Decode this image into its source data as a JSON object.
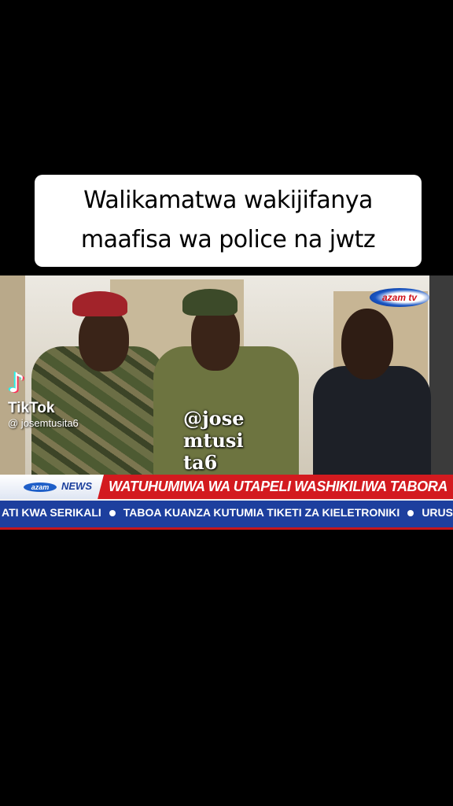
{
  "caption": {
    "line1": "Walikamatwa wakijifanya",
    "line2": "maafisa wa police na jwtz"
  },
  "tiktok": {
    "brand": "TikTok",
    "username": "@ josemtusita6"
  },
  "watermark": "@jose\nmtusi\nta6",
  "channel_logo": "azam tv",
  "news_badge": {
    "azam": "azam",
    "news": "NEWS"
  },
  "headline": "WATUHUMIWA WA UTAPELI WASHIKILIWA TABORA",
  "ticker": [
    "ATI KWA SERIKALI",
    "TABOA KUANZA KUTUMIA TIKETI ZA KIELETRONIKI",
    "URUSI YAKIRI KUWA"
  ],
  "colors": {
    "newsbar_red": "#d31a1f",
    "ticker_blue": "#1d3f9e"
  }
}
